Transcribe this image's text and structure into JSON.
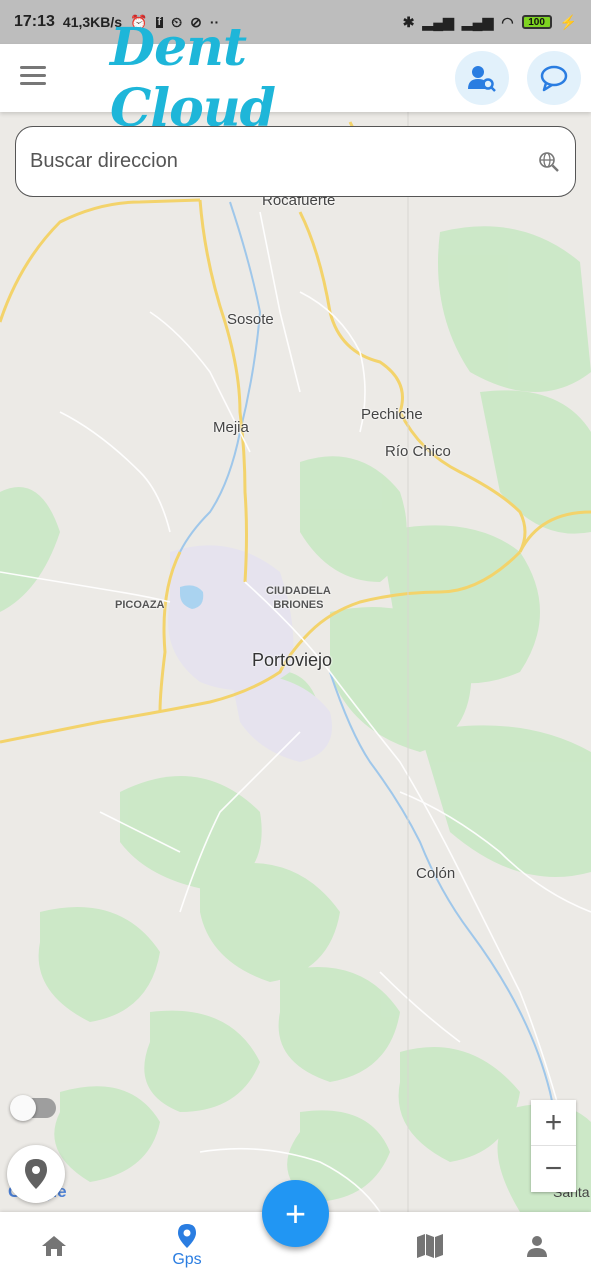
{
  "status_bar": {
    "time": "17:13",
    "speed": "41,3KB/s",
    "battery": "100"
  },
  "header": {
    "logo_text": "Dent Cloud",
    "menu_icon": "hamburger-icon",
    "search_user_icon": "user-search-icon",
    "chat_icon": "chat-bubble-icon"
  },
  "search": {
    "placeholder": "Buscar direccion",
    "icon": "globe-search-icon"
  },
  "map": {
    "places": {
      "rocafuerte": "Rocafuerte",
      "sosote": "Sosote",
      "pechiche": "Pechiche",
      "mejia": "Mejia",
      "rio_chico": "Río Chico",
      "picoaza": "PICOAZA",
      "ciudadela_l1": "CIUDADELA",
      "ciudadela_l2": "BRIONES",
      "portoviejo": "Portoviejo",
      "colon": "Colón",
      "santa": "Santa"
    },
    "google_logo": "Google",
    "zoom_in": "+",
    "zoom_out": "−"
  },
  "fab_label": "+",
  "bottom_nav": {
    "items": [
      {
        "icon": "home-icon",
        "label": ""
      },
      {
        "icon": "location-pin-icon",
        "label": "Gps"
      },
      {
        "icon": "map-book-icon",
        "label": ""
      },
      {
        "icon": "person-icon",
        "label": ""
      }
    ]
  },
  "colors": {
    "accent": "#2196f3",
    "logo": "#1eb6d9",
    "active_nav": "#2a7de1"
  }
}
